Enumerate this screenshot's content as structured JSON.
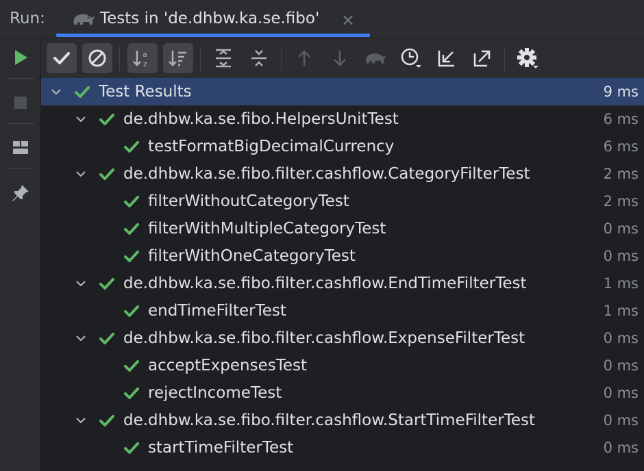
{
  "header": {
    "run_label": "Run:",
    "tab_title": "Tests in 'de.dhbw.ka.se.fibo'",
    "tab_close": "×"
  },
  "colors": {
    "pass_green": "#5fb865",
    "accent_blue": "#3d7ef6",
    "selection": "#2e436e"
  },
  "toolbar": {
    "buttons": [
      {
        "name": "show-passed-toggle",
        "icon": "check-icon",
        "active": true
      },
      {
        "name": "show-ignored-toggle",
        "icon": "ban-icon",
        "active": true
      },
      {
        "name": "sort-alphabetically-button",
        "icon": "sort-alpha-icon"
      },
      {
        "name": "sort-by-duration-button",
        "icon": "sort-duration-icon"
      },
      {
        "name": "expand-all-button",
        "icon": "expand-all-icon"
      },
      {
        "name": "collapse-all-button",
        "icon": "collapse-all-icon"
      },
      {
        "name": "previous-failed-button",
        "icon": "arrow-up-icon"
      },
      {
        "name": "next-failed-button",
        "icon": "arrow-down-icon"
      },
      {
        "name": "gradle-button",
        "icon": "gradle-elephant-icon"
      },
      {
        "name": "test-history-button",
        "icon": "history-clock-icon"
      },
      {
        "name": "import-tests-button",
        "icon": "import-icon"
      },
      {
        "name": "export-tests-button",
        "icon": "export-icon"
      },
      {
        "name": "settings-button",
        "icon": "gear-icon"
      }
    ]
  },
  "sidebar": {
    "buttons": [
      {
        "name": "rerun-button",
        "icon": "play-icon"
      },
      {
        "name": "stop-button",
        "icon": "stop-icon"
      },
      {
        "name": "layout-button",
        "icon": "layout-icon"
      },
      {
        "name": "pin-button",
        "icon": "pin-icon"
      }
    ]
  },
  "tree": {
    "rows": [
      {
        "label": "Test Results",
        "time": "9 ms",
        "level": 0,
        "expandable": true,
        "selected": true
      },
      {
        "label": "de.dhbw.ka.se.fibo.HelpersUnitTest",
        "time": "6 ms",
        "level": 1,
        "expandable": true
      },
      {
        "label": "testFormatBigDecimalCurrency",
        "time": "6 ms",
        "level": 2,
        "expandable": false
      },
      {
        "label": "de.dhbw.ka.se.fibo.filter.cashflow.CategoryFilterTest",
        "time": "2 ms",
        "level": 1,
        "expandable": true
      },
      {
        "label": "filterWithoutCategoryTest",
        "time": "2 ms",
        "level": 2,
        "expandable": false
      },
      {
        "label": "filterWithMultipleCategoryTest",
        "time": "0 ms",
        "level": 2,
        "expandable": false
      },
      {
        "label": "filterWithOneCategoryTest",
        "time": "0 ms",
        "level": 2,
        "expandable": false
      },
      {
        "label": "de.dhbw.ka.se.fibo.filter.cashflow.EndTimeFilterTest",
        "time": "1 ms",
        "level": 1,
        "expandable": true
      },
      {
        "label": "endTimeFilterTest",
        "time": "1 ms",
        "level": 2,
        "expandable": false
      },
      {
        "label": "de.dhbw.ka.se.fibo.filter.cashflow.ExpenseFilterTest",
        "time": "0 ms",
        "level": 1,
        "expandable": true
      },
      {
        "label": "acceptExpensesTest",
        "time": "0 ms",
        "level": 2,
        "expandable": false
      },
      {
        "label": "rejectIncomeTest",
        "time": "0 ms",
        "level": 2,
        "expandable": false
      },
      {
        "label": "de.dhbw.ka.se.fibo.filter.cashflow.StartTimeFilterTest",
        "time": "0 ms",
        "level": 1,
        "expandable": true
      },
      {
        "label": "startTimeFilterTest",
        "time": "0 ms",
        "level": 2,
        "expandable": false
      }
    ]
  }
}
